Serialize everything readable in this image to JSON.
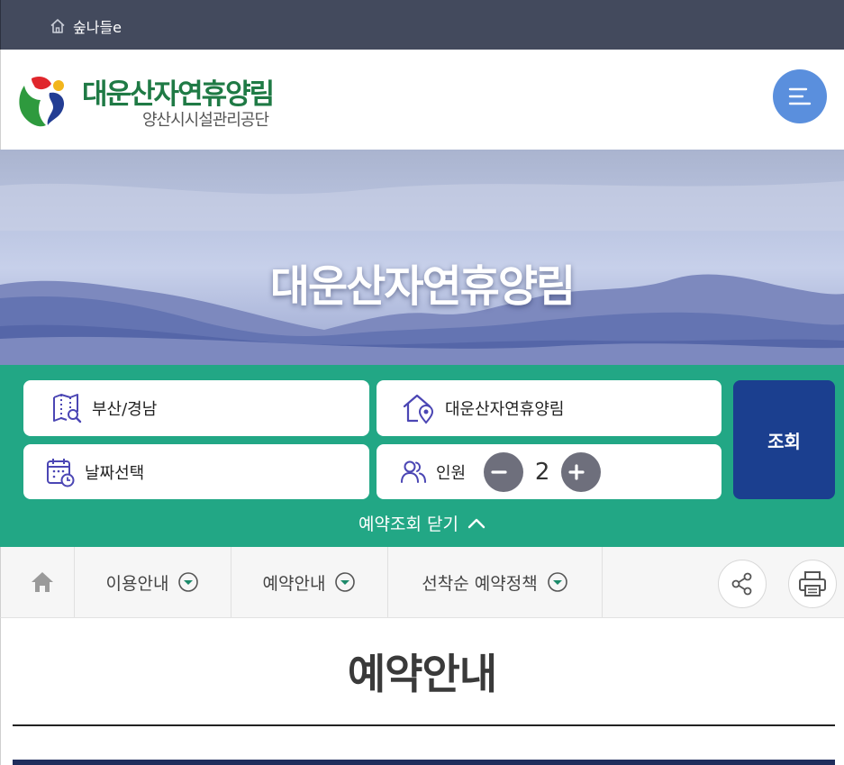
{
  "topbar": {
    "home_label": "숲나들e"
  },
  "header": {
    "logo_title": "대운산자연휴양림",
    "logo_subtitle": "양산시시설관리공단",
    "menu_icon": "hamburger-menu-icon"
  },
  "hero": {
    "title": "대운산자연휴양림"
  },
  "search": {
    "region_value": "부산/경남",
    "forest_value": "대운산자연휴양림",
    "date_value": "날짜선택",
    "people_label": "인원",
    "people_count": "2",
    "query_label": "조회",
    "toggle_label": "예약조회 닫기"
  },
  "subnav": {
    "items": [
      {
        "label": "이용안내"
      },
      {
        "label": "예약안내"
      },
      {
        "label": "선착순 예약정책"
      }
    ]
  },
  "page": {
    "title": "예약안내"
  },
  "colors": {
    "topbar": "#434a5d",
    "menu_button": "#5a8fdd",
    "search_panel": "#22a785",
    "query_button": "#1b3f8f",
    "stepper": "#6e6f7c"
  }
}
